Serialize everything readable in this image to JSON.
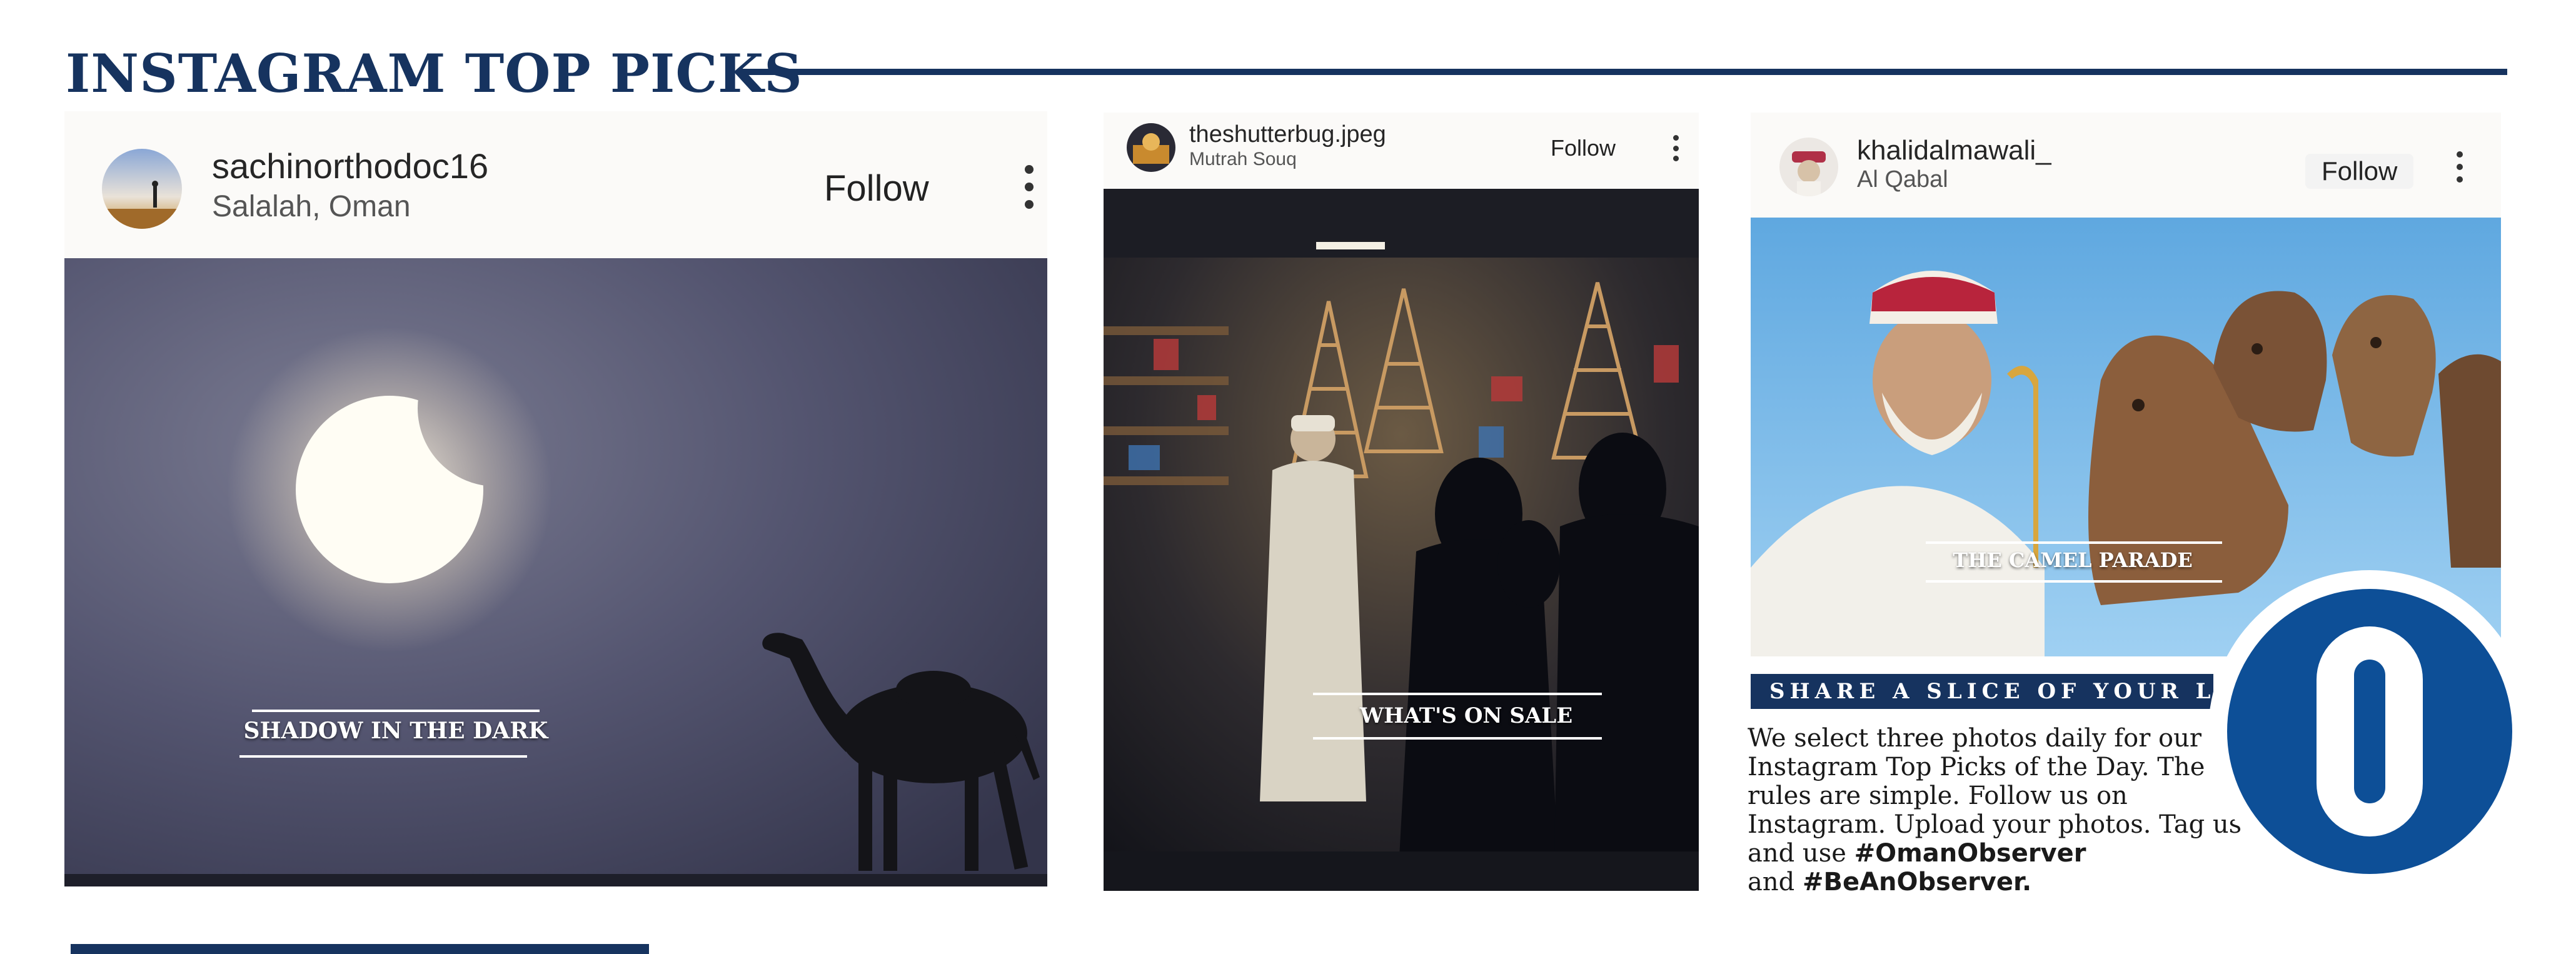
{
  "section": {
    "title": "INSTAGRAM TOP PICKS"
  },
  "colors": {
    "navy": "#16335f",
    "logo_blue": "#0d4f97",
    "card_bg": "#fbfaf8"
  },
  "posts": [
    {
      "username": "sachinorthodoc16",
      "location": "Salalah, Oman",
      "follow_label": "Follow",
      "more_icon": "more-vertical-icon",
      "caption": "SHADOW IN THE DARK"
    },
    {
      "username": "theshutterbug.jpeg",
      "location": "Mutrah Souq",
      "follow_label": "Follow",
      "more_icon": "more-vertical-icon",
      "caption": "WHAT'S ON SALE"
    },
    {
      "username": "khalidalmawali_",
      "location": "Al Qabal",
      "follow_label": "Follow",
      "more_icon": "more-vertical-icon",
      "caption": "THE CAMEL PARADE"
    }
  ],
  "share": {
    "heading": "SHARE A SLICE OF YOUR LIFE",
    "body": "We select three photos daily for our Instagram Top Picks of the Day. The rules are simple. Follow us on Instagram. Upload your photos. Tag us and use",
    "hashtag1": "#OmanObserver",
    "connector": "and",
    "hashtag2": "#BeAnObserver."
  },
  "logo": {
    "letter": "O"
  }
}
